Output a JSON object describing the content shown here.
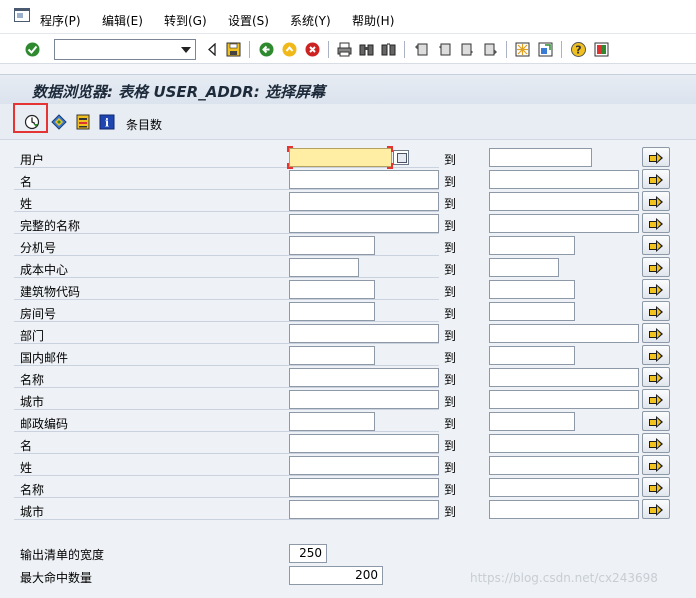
{
  "menu": {
    "items": [
      "程序(P)",
      "编辑(E)",
      "转到(G)",
      "设置(S)",
      "系统(Y)",
      "帮助(H)"
    ]
  },
  "command_field": {
    "value": ""
  },
  "title": "数据浏览器: 表格 USER_ADDR: 选择屏幕",
  "app_toolbar": {
    "record_count_label": "条目数"
  },
  "rows": [
    {
      "label": "用户"
    },
    {
      "label": "名"
    },
    {
      "label": "姓"
    },
    {
      "label": "完整的名称"
    },
    {
      "label": "分机号"
    },
    {
      "label": "成本中心"
    },
    {
      "label": "建筑物代码"
    },
    {
      "label": "房间号"
    },
    {
      "label": "部门"
    },
    {
      "label": "国内邮件"
    },
    {
      "label": "名称"
    },
    {
      "label": "城市"
    },
    {
      "label": "邮政编码"
    },
    {
      "label": "名"
    },
    {
      "label": "姓"
    },
    {
      "label": "名称"
    },
    {
      "label": "城市"
    }
  ],
  "to_label": "到",
  "output_width": {
    "label": "输出清单的宽度",
    "value": "250"
  },
  "max_hits": {
    "label": "最大命中数量",
    "value": "200"
  },
  "watermark": "https://blog.csdn.net/cx243698",
  "icons": {
    "app": "window-icon",
    "enter": "checkmark-icon",
    "back": "back-icon",
    "exit": "exit-icon",
    "cancel": "cancel-icon",
    "print": "print-icon",
    "find": "find-icon",
    "execute": "execute-icon"
  },
  "colors": {
    "active_field": "#ffeea3",
    "highlight": "#e53434"
  }
}
